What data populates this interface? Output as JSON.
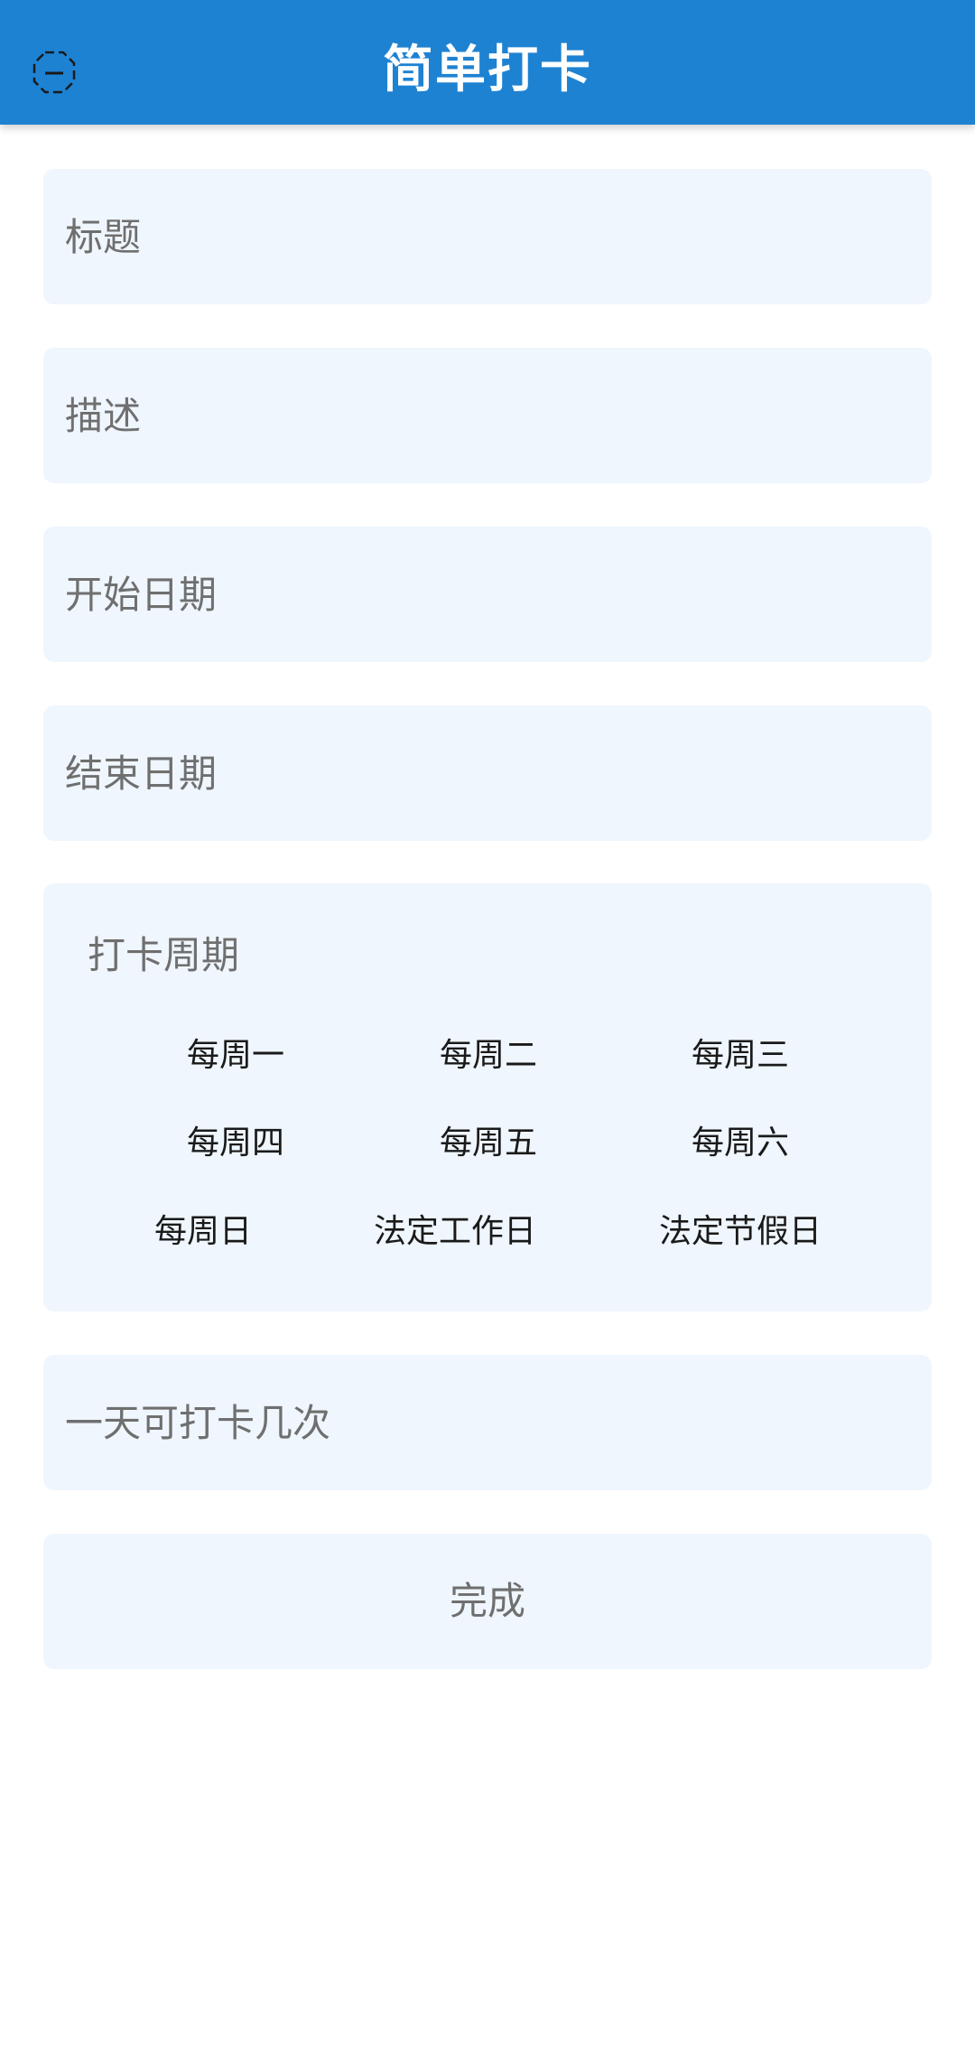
{
  "appbar": {
    "title": "简单打卡",
    "back_icon": "back-arrow-icon",
    "color": "#1e82d2"
  },
  "form": {
    "title_placeholder": "标题",
    "description_placeholder": "描述",
    "start_date_placeholder": "开始日期",
    "end_date_placeholder": "结束日期",
    "times_per_day_placeholder": "一天可打卡几次",
    "field_background": "#eff6fd"
  },
  "cycle": {
    "label": "打卡周期",
    "options": [
      "每周一",
      "每周二",
      "每周三",
      "每周四",
      "每周五",
      "每周六",
      "每周日",
      "法定工作日",
      "法定节假日"
    ]
  },
  "done_button": {
    "label": "完成"
  }
}
